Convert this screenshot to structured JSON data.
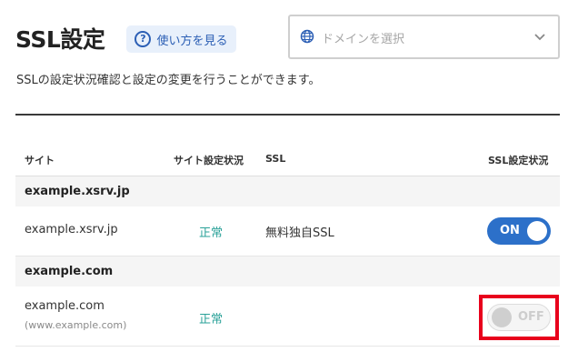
{
  "header": {
    "title": "SSL設定",
    "help_button_label": "使い方を見る"
  },
  "domain_select": {
    "placeholder": "ドメインを選択"
  },
  "description": "SSLの設定状況確認と設定の変更を行うことができます。",
  "table": {
    "columns": [
      "サイト",
      "サイト設定状況",
      "SSL",
      "SSL設定状況"
    ],
    "groups": [
      {
        "name": "example.xsrv.jp",
        "rows": [
          {
            "site": "example.xsrv.jp",
            "site_sub": "",
            "status": "正常",
            "ssl": "無料独自SSL",
            "toggle": "ON"
          }
        ]
      },
      {
        "name": "example.com",
        "rows": [
          {
            "site": "example.com",
            "site_sub": "(www.example.com)",
            "status": "正常",
            "ssl": "",
            "toggle": "OFF"
          }
        ]
      }
    ]
  },
  "colors": {
    "accent": "#2c70c9",
    "status_ok": "#2aa198",
    "highlight": "#e8001c"
  }
}
